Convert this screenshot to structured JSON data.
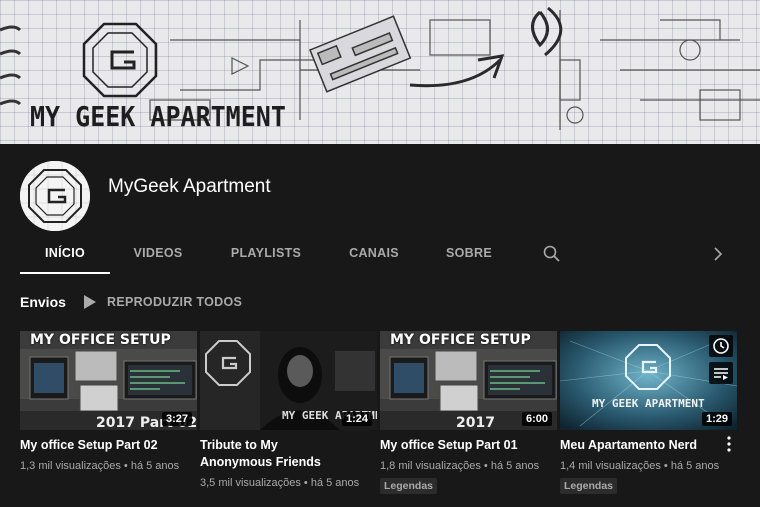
{
  "banner": {
    "logo_text": "MY GEEK APARTMENT"
  },
  "channel": {
    "name": "MyGeek Apartment"
  },
  "tabs": [
    {
      "label": "INÍCIO",
      "active": true
    },
    {
      "label": "VIDEOS",
      "active": false
    },
    {
      "label": "PLAYLISTS",
      "active": false
    },
    {
      "label": "CANAIS",
      "active": false
    },
    {
      "label": "SOBRE",
      "active": false
    }
  ],
  "tab_icons": {
    "search": "search-icon",
    "next": "chevron-right-icon"
  },
  "section": {
    "title": "Envios",
    "play_all_label": "REPRODUZIR TODOS",
    "play_icon": "play-icon"
  },
  "videos": [
    {
      "thumb_text": "MY OFFICE SETUP",
      "thumb_year": "2017 Part 02",
      "duration": "3:27",
      "title": "My office Setup Part 02",
      "meta": "1,3 mil visualizações • há 5 anos"
    },
    {
      "thumb_text": "MY GEEK APARTMENT",
      "duration": "1:24",
      "title": "Tribute to My Anonymous Friends",
      "meta": "3,5 mil visualizações • há 5 anos"
    },
    {
      "thumb_text": "MY OFFICE SETUP",
      "thumb_year": "2017",
      "duration": "6:00",
      "title": "My office Setup Part 01",
      "meta": "1,8 mil visualizações • há 5 anos",
      "badge": "Legendas"
    },
    {
      "thumb_text": "MY GEEK APARTMENT",
      "duration": "1:29",
      "title": "Meu Apartamento Nerd",
      "meta": "1,4 mil visualizações • há 5 anos",
      "badge": "Legendas"
    }
  ],
  "colors": {
    "background": "#181818",
    "text_primary": "#ffffff",
    "text_secondary": "#aaaaaa",
    "badge_bg": "#2c2c2c"
  }
}
